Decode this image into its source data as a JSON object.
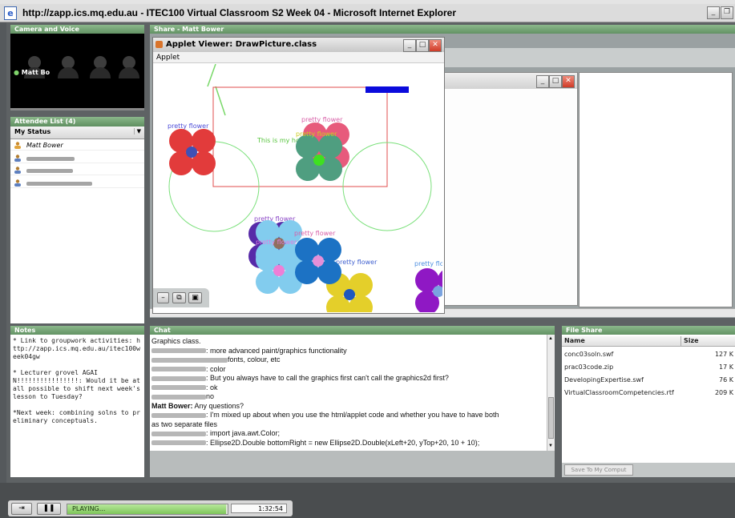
{
  "browser": {
    "title": "http://zapp.ics.mq.edu.au - ITEC100 Virtual Classroom S2 Week 04 - Microsoft Internet Explorer",
    "min_glyph": "_",
    "restore_glyph": "❐"
  },
  "panels": {
    "camera_title": "Camera and Voice",
    "share_title": "Share - Matt Bower",
    "attendee_title": "Attendee List (4)",
    "notes_title": "Notes",
    "chat_title": "Chat",
    "fileshare_title": "File Share"
  },
  "camera": {
    "label": "Matt Bo"
  },
  "attendees": {
    "status_label": "My Status",
    "presenter": "Matt Bower"
  },
  "applet": {
    "title": "Applet Viewer: DrawPicture.class",
    "menu": "Applet",
    "flower_label": "pretty flower",
    "house_text": "This is my ho"
  },
  "notes": {
    "text": "* Link to groupwork activities: http://zapp.ics.mq.edu.au/itec100week04gw\n\n* Lecturer grovel AGAIN!!!!!!!!!!!!!!!!: Would it be at all possible to shift next week's lesson to Tuesday?\n\n*Next week: combining solns to preliminary conceptuals."
  },
  "chat": {
    "lines": [
      {
        "who": "",
        "text": "Graphics class."
      },
      {
        "who": "",
        "text": ": more advanced paint/graphics functionality"
      },
      {
        "who": "",
        "text": "fonts, colour, etc"
      },
      {
        "who": "",
        "text": ": color"
      },
      {
        "who": "",
        "text": ": But you always have to call the graphics first can't call the graphics2d first?"
      },
      {
        "who": "",
        "text": ": ok"
      },
      {
        "who": "",
        "text": "no"
      },
      {
        "who": "Matt Bower:",
        "text": " Any questions?"
      },
      {
        "who": "",
        "text": ": I'm mixed up about when you use the html/applet code and whether you have to have both"
      },
      {
        "who": "",
        "text": "as two separate files"
      },
      {
        "who": "",
        "text": ": import java.awt.Color;"
      },
      {
        "who": "",
        "text": ": Ellipse2D.Double bottomRight = new Ellipse2D.Double(xLeft+20, yTop+20, 10 + 10);"
      }
    ]
  },
  "fileshare": {
    "col_name": "Name",
    "col_size": "Size",
    "files": [
      {
        "name": "conc03soln.swf",
        "size": "127 K"
      },
      {
        "name": "prac03code.zip",
        "size": "17 K"
      },
      {
        "name": "DevelopingExpertise.swf",
        "size": "76 K"
      },
      {
        "name": "VirtualClassroomCompetencies.rtf",
        "size": "209 K"
      }
    ],
    "save_button": "Save To My Comput"
  },
  "playback": {
    "status": "PLAYING...",
    "time": "1:32:54",
    "progress": 1.0
  },
  "colors": {
    "panel_header": "#6b9b6c",
    "progress_fill": "#7ec55a"
  }
}
